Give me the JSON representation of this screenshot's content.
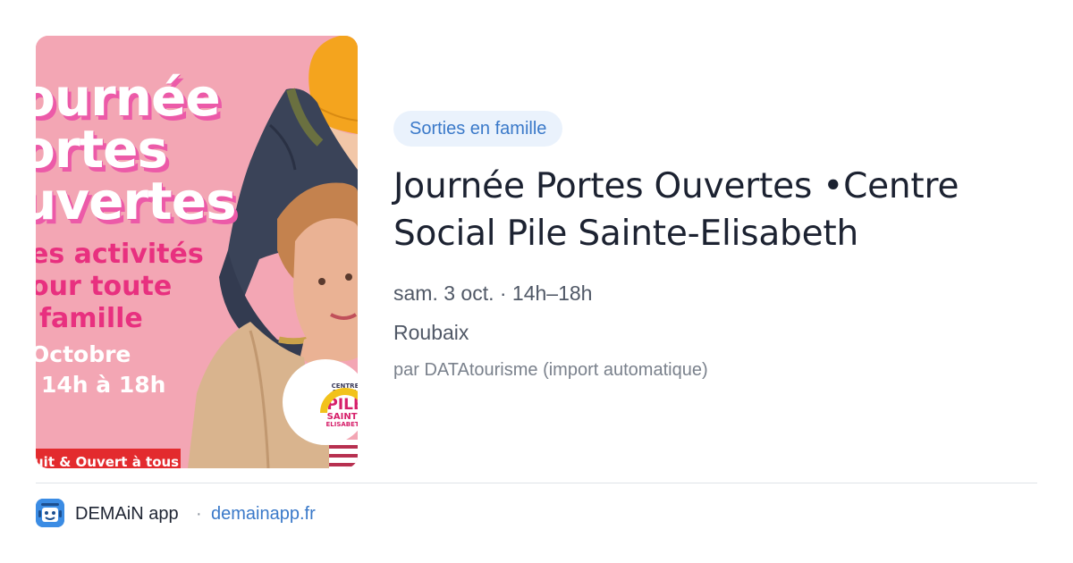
{
  "poster": {
    "lines_big": [
      "ournée",
      "ortes",
      "uvertes"
    ],
    "lines_pink": [
      "es activités",
      "our toute",
      "famille"
    ],
    "lines_white": [
      "Octobre",
      "14h à 18h"
    ],
    "banner": "uit & Ouvert à tous",
    "logo": {
      "line1": "CENTRE SOCIAL",
      "line2": "PILE",
      "line3": "SAINTE",
      "line4": "ELISABETH"
    }
  },
  "event": {
    "category": "Sorties en famille",
    "title": "Journée Portes Ouvertes •Centre Social Pile Sainte-Elisabeth",
    "datetime": "sam. 3 oct. · 14h–18h",
    "location": "Roubaix",
    "source": "par DATAtourisme (import automatique)"
  },
  "footer": {
    "app_name": "DEMAiN app",
    "separator": "·",
    "domain": "demainapp.fr"
  },
  "colors": {
    "accent": "#3a79c9",
    "tag_bg": "#eaf2fc",
    "poster_bg": "#f3a6b4",
    "poster_pink": "#e8307f",
    "banner_red": "#e32b2e"
  },
  "icons": {
    "app": "demain-app-icon"
  }
}
